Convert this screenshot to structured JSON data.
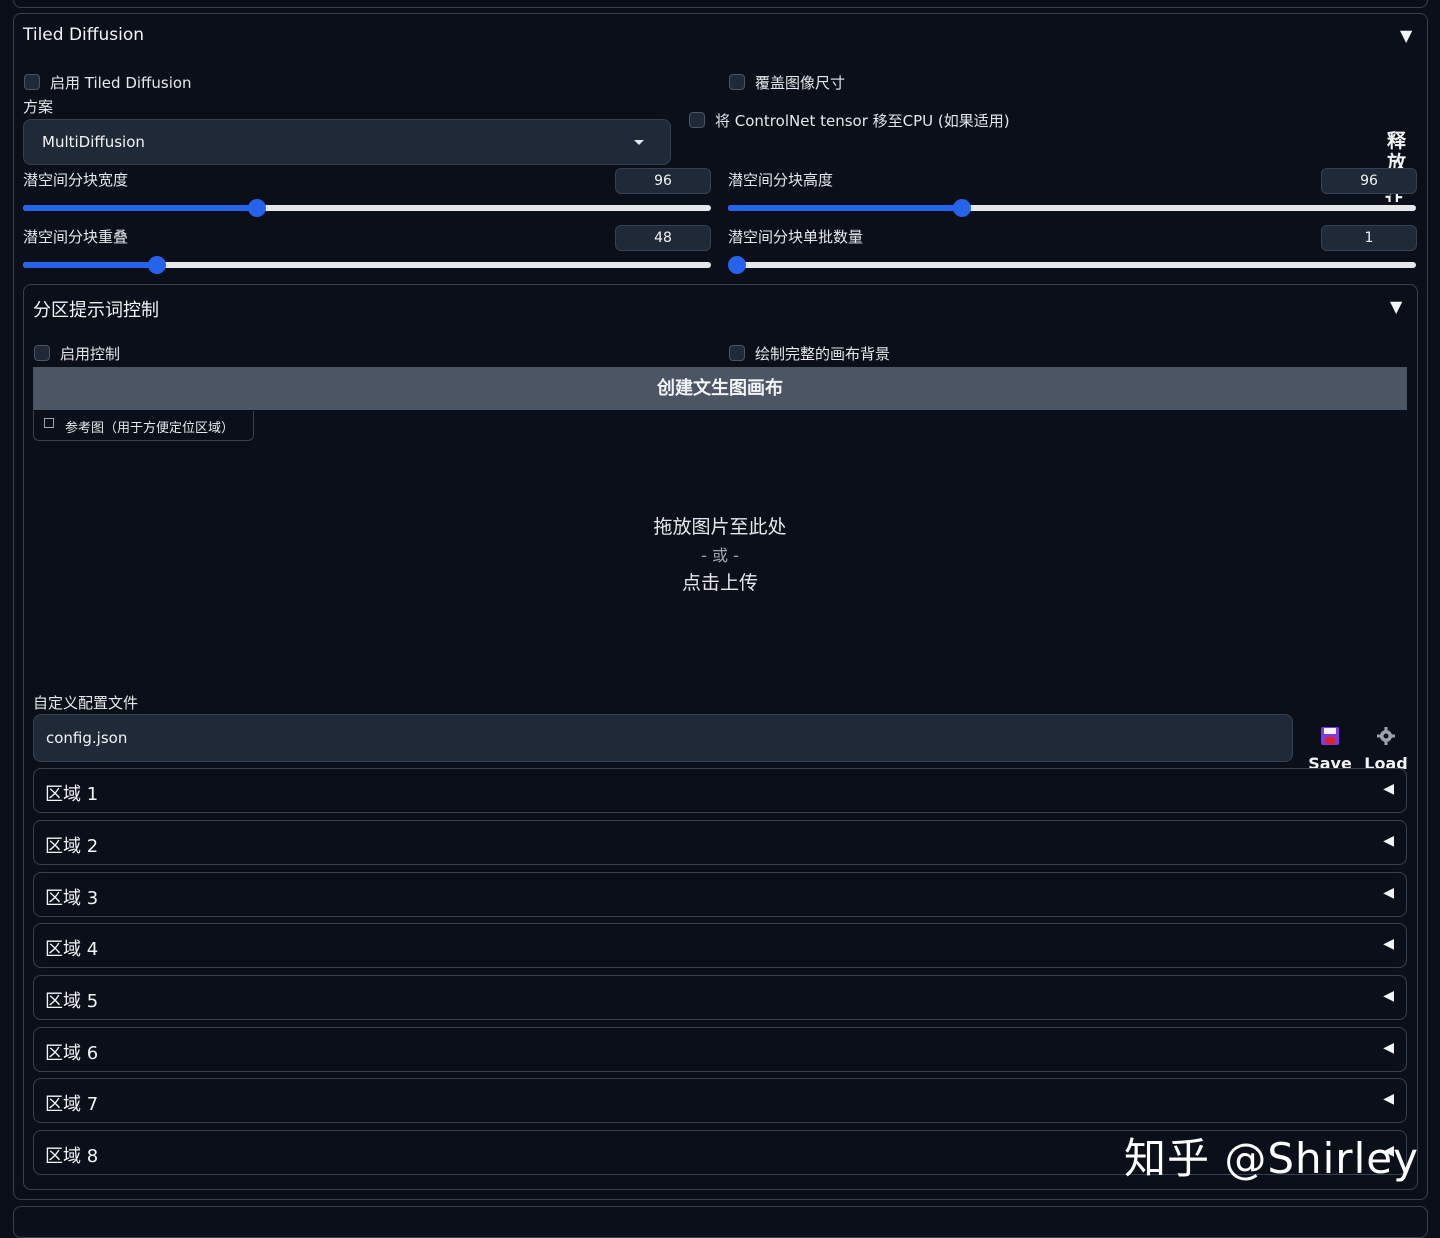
{
  "tiled": {
    "title": "Tiled Diffusion",
    "caret": "▼",
    "enable_label": "启用 Tiled Diffusion",
    "overwrite_size_label": "覆盖图像尺寸",
    "move_controlnet_label": "将 ControlNet tensor 移至CPU (如果适用)",
    "method_label": "方案",
    "method_value": "MultiDiffusion",
    "side_text_1": "释",
    "side_text_2": "放",
    "side_text_3": "让"
  },
  "sliders": {
    "tile_width": {
      "label": "潜空间分块宽度",
      "value": "96",
      "fraction": 0.34
    },
    "tile_height": {
      "label": "潜空间分块高度",
      "value": "96",
      "fraction": 0.34
    },
    "tile_overlap": {
      "label": "潜空间分块重叠",
      "value": "48",
      "fraction": 0.195
    },
    "tile_batch": {
      "label": "潜空间分块单批数量",
      "value": "1",
      "fraction": 0.0
    }
  },
  "region_control": {
    "title": "分区提示词控制",
    "caret": "▼",
    "enable_label": "启用控制",
    "draw_background_label": "绘制完整的画布背景",
    "create_canvas_label": "创建文生图画布",
    "ref_tab_label": "参考图（用于方便定位区域）",
    "drop_text": "拖放图片至此处",
    "drop_or": "- 或 -",
    "drop_click": "点击上传",
    "config_label": "自定义配置文件",
    "config_value": "config.json",
    "save_label": "Save",
    "load_label": "Load"
  },
  "regions": [
    {
      "label": "区域 1",
      "caret": "◀"
    },
    {
      "label": "区域 2",
      "caret": "◀"
    },
    {
      "label": "区域 3",
      "caret": "◀"
    },
    {
      "label": "区域 4",
      "caret": "◀"
    },
    {
      "label": "区域 5",
      "caret": "◀"
    },
    {
      "label": "区域 6",
      "caret": "◀"
    },
    {
      "label": "区域 7",
      "caret": "◀"
    },
    {
      "label": "区域 8",
      "caret": "◀"
    }
  ],
  "watermark": "知乎 @Shirley",
  "colors": {
    "accent": "#2563eb",
    "background": "#0b0f19",
    "button": "#4b5563"
  }
}
